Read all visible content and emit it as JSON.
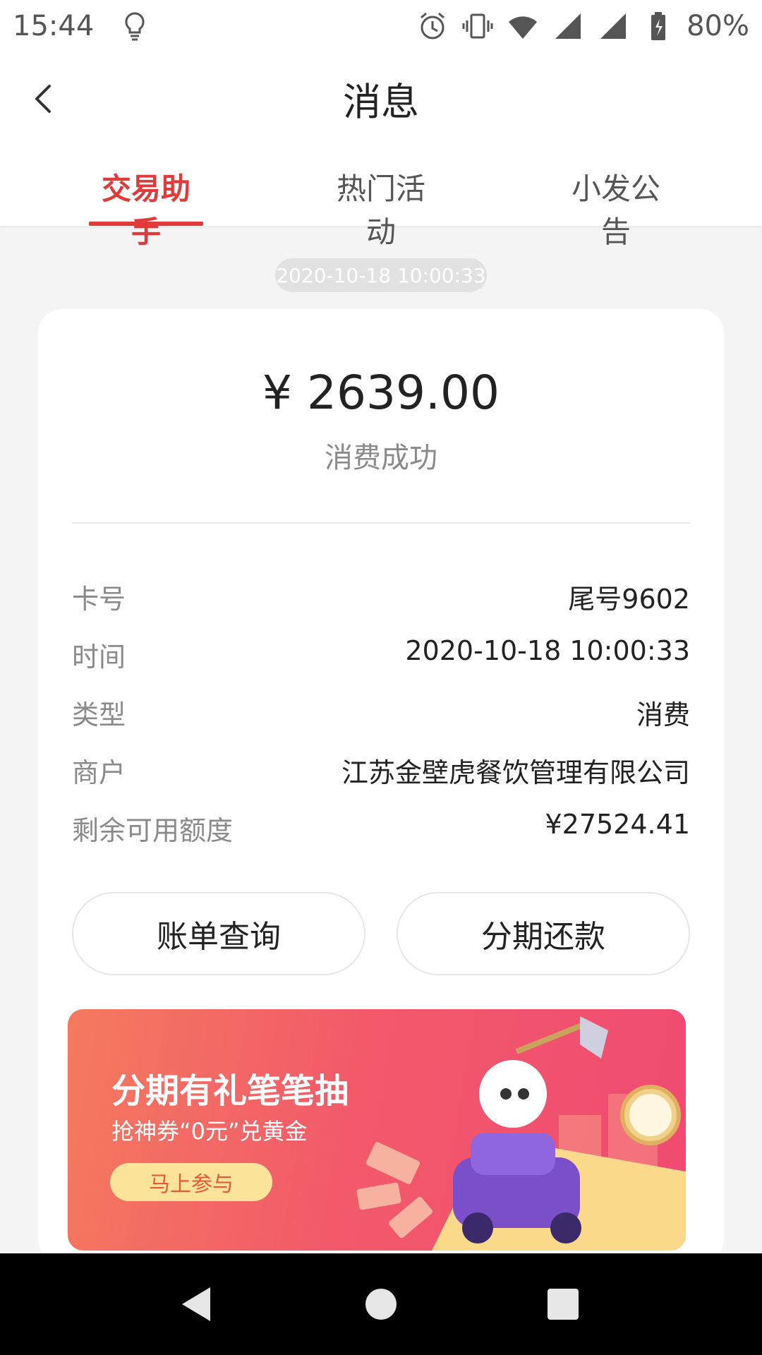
{
  "status_bar": {
    "time": "15:44",
    "battery": "80%",
    "icons": [
      "lightbulb-icon",
      "alarm-icon",
      "vibrate-icon",
      "wifi-icon",
      "signal-icon",
      "signal-icon",
      "battery-icon"
    ]
  },
  "header": {
    "title": "消息",
    "back_icon": "chevron-left-icon"
  },
  "tabs": [
    {
      "label": "交易助手",
      "active": true
    },
    {
      "label": "热门活动",
      "active": false
    },
    {
      "label": "小发公告",
      "active": false
    }
  ],
  "message": {
    "timestamp": "2020-10-18 10:00:33",
    "amount": "¥ 2639.00",
    "status": "消费成功",
    "details": [
      {
        "label": "卡号",
        "value": "尾号9602"
      },
      {
        "label": "时间",
        "value": "2020-10-18  10:00:33"
      },
      {
        "label": "类型",
        "value": "消费"
      },
      {
        "label": "商户",
        "value": "江苏金壁虎餐饮管理有限公司"
      },
      {
        "label": "剩余可用额度",
        "value": "¥27524.41"
      }
    ],
    "buttons": {
      "bill_query": "账单查询",
      "installment": "分期还款"
    }
  },
  "banner": {
    "title": "分期有礼笔笔抽",
    "subtitle": "抢神券“0元”兑黄金",
    "button": "马上参与"
  },
  "colors": {
    "accent": "#e03a3a",
    "banner_button": "#fbe39a"
  }
}
